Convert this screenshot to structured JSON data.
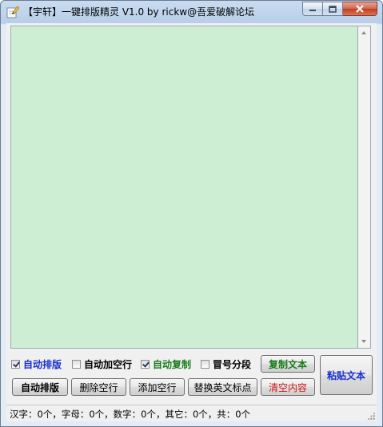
{
  "window": {
    "title": "【宇轩】一键排版精灵 V1.0 by rickw@吾爱破解论坛"
  },
  "options": [
    {
      "label": "自动排版",
      "checked": true,
      "color": "#1a2fd0"
    },
    {
      "label": "自动加空行",
      "checked": false,
      "color": "#000000"
    },
    {
      "label": "自动复制",
      "checked": true,
      "color": "#1a7a1a"
    },
    {
      "label": "冒号分段",
      "checked": false,
      "color": "#000000"
    }
  ],
  "buttons": {
    "copy": {
      "label": "复制文本",
      "color": "#1a7a1a"
    },
    "paste": {
      "label": "粘贴文本",
      "color": "#1a2fd0"
    },
    "auto_format": {
      "label": "自动排版",
      "color": "#000000"
    },
    "delete_blank": {
      "label": "删除空行",
      "color": "#000000"
    },
    "add_blank": {
      "label": "添加空行",
      "color": "#000000"
    },
    "replace_punct": {
      "label": "替换英文标点",
      "color": "#000000"
    },
    "clear": {
      "label": "清空内容",
      "color": "#d01818"
    }
  },
  "editor": {
    "background": "#cdeed3"
  },
  "status": {
    "text": "汉字：0个，字母：0个，数字：0个，其它：0个，共：0个"
  }
}
